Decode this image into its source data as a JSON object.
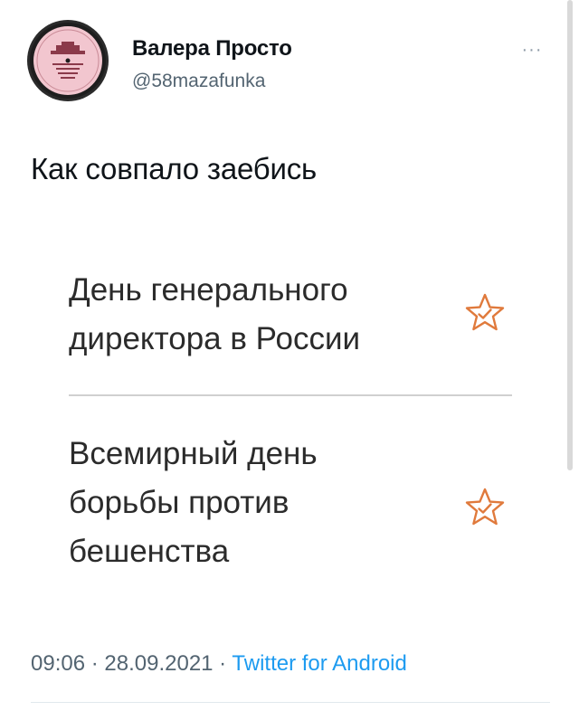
{
  "tweet": {
    "author": {
      "display_name": "Валера Просто",
      "handle": "@58mazafunka",
      "avatar_icon": "vinyl-record-label-avatar"
    },
    "more_icon": "more-horizontal-icon",
    "more_label": "···",
    "text": "Как совпало заебись",
    "holidays": [
      {
        "title": "День генерального\nдиректора в России",
        "icon": "star-check-icon"
      },
      {
        "title": "Всемирный день\nборьбы против\nбешенства",
        "icon": "star-check-icon"
      }
    ],
    "time": "09:06",
    "separator": " · ",
    "date": "28.09.2021",
    "source": "Twitter for Android"
  },
  "colors": {
    "star": "#e07a3c",
    "link": "#1d9bf0",
    "avatar_label": "#f2c6cf"
  }
}
